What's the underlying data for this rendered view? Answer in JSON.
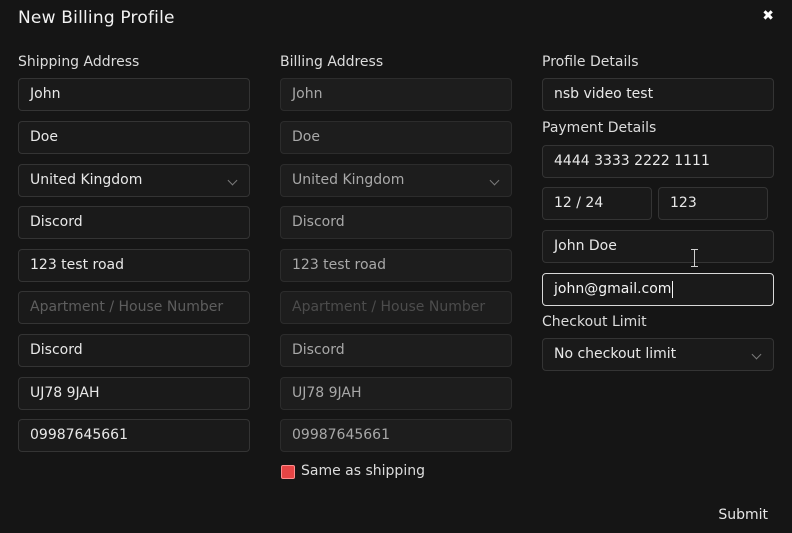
{
  "modal": {
    "title": "New Billing Profile",
    "close_glyph": "✖",
    "submit_label": "Submit"
  },
  "shipping": {
    "heading": "Shipping Address",
    "first_name": "John",
    "last_name": "Doe",
    "country": "United Kingdom",
    "address_line": "Discord",
    "street": "123 test road",
    "apartment_placeholder": "Apartment / House Number",
    "city": "Discord",
    "postcode": "UJ78 9JAH",
    "phone": "09987645661"
  },
  "billing": {
    "heading": "Billing Address",
    "first_name": "John",
    "last_name": "Doe",
    "country": "United Kingdom",
    "address_line": "Discord",
    "street": "123 test road",
    "apartment_placeholder": "Apartment / House Number",
    "city": "Discord",
    "postcode": "UJ78 9JAH",
    "phone": "09987645661",
    "same_as_shipping_label": "Same as shipping",
    "same_as_shipping_checked": true
  },
  "profile": {
    "heading": "Profile Details",
    "name": "nsb video test"
  },
  "payment": {
    "heading": "Payment Details",
    "card_number": "4444 3333 2222 1111",
    "expiry": "12 / 24",
    "cvv": "123",
    "cardholder": "John Doe",
    "email": "john@gmail.com"
  },
  "checkout": {
    "heading": "Checkout Limit",
    "selected": "No checkout limit"
  },
  "colors": {
    "background": "#151515",
    "field_border": "#343434",
    "focus_border": "#d8d8d8",
    "checkbox": "#e64545"
  },
  "icons": {
    "close": "close-icon",
    "dropdown": "chevron-down-icon",
    "cursor": "text-cursor-icon"
  }
}
